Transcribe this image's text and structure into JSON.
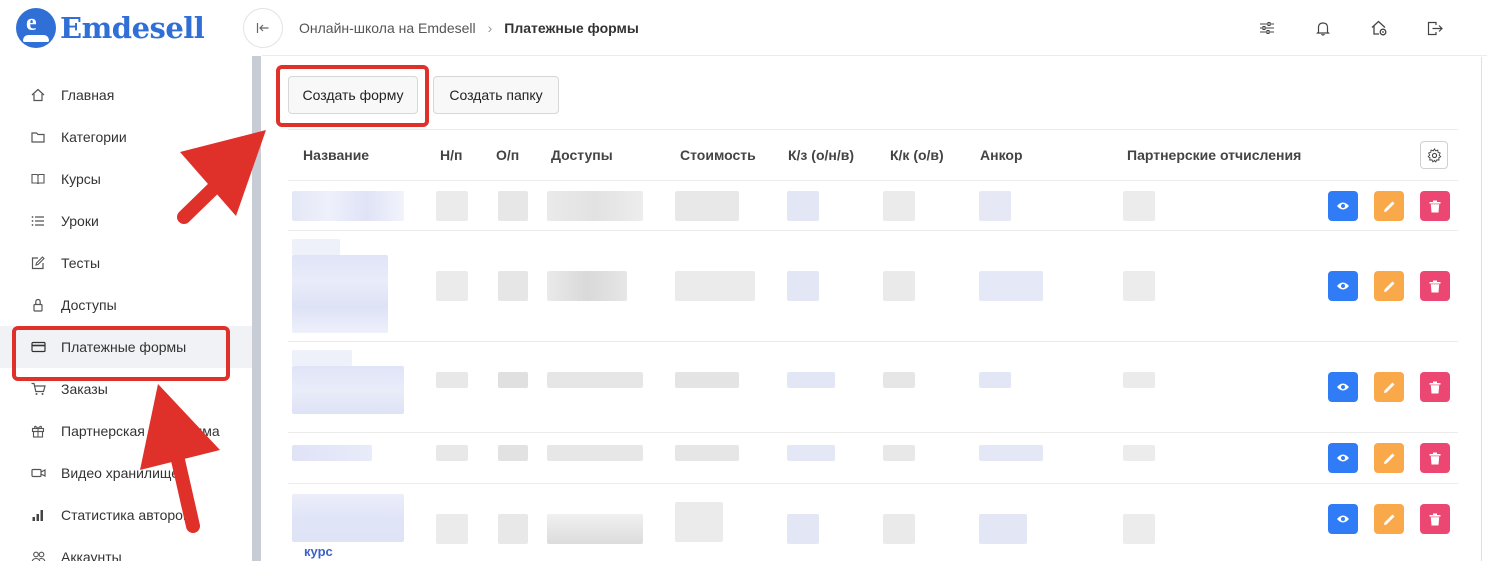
{
  "brand": {
    "name": "Emdesell",
    "badge_letter": "e",
    "color": "#2f6fd6"
  },
  "header": {
    "breadcrumb": [
      "Онлайн-школа на Emdesell",
      "Платежные формы"
    ],
    "icons": [
      "sliders-icon",
      "bell-icon",
      "home-settings-icon",
      "logout-icon"
    ]
  },
  "sidebar": {
    "items": [
      {
        "label": "Главная",
        "icon": "home-icon"
      },
      {
        "label": "Категории",
        "icon": "folder-icon"
      },
      {
        "label": "Курсы",
        "icon": "book-icon"
      },
      {
        "label": "Уроки",
        "icon": "list-icon"
      },
      {
        "label": "Тесты",
        "icon": "edit-icon"
      },
      {
        "label": "Доступы",
        "icon": "lock-icon"
      },
      {
        "label": "Платежные формы",
        "icon": "credit-card-icon",
        "active": true
      },
      {
        "label": "Заказы",
        "icon": "cart-icon"
      },
      {
        "label": "Партнерская программа",
        "icon": "gift-icon"
      },
      {
        "label": "Видео хранилище",
        "icon": "video-icon"
      },
      {
        "label": "Статистика авторов",
        "icon": "bar-chart-icon"
      },
      {
        "label": "Аккаунты",
        "icon": "users-icon"
      }
    ]
  },
  "toolbar": {
    "create_form": "Создать форму",
    "create_folder": "Создать папку"
  },
  "table": {
    "columns": [
      "Название",
      "Н/п",
      "О/п",
      "Доступы",
      "Стоимость",
      "К/з (о/н/в)",
      "К/к (о/в)",
      "Анкор",
      "Партнерские отчисления"
    ],
    "rows": [
      {
        "name": "",
        "note": "blurred"
      },
      {
        "name": "",
        "note": "blurred"
      },
      {
        "name": "",
        "note": "blurred"
      },
      {
        "name": "",
        "note": "blurred"
      },
      {
        "name": "курс",
        "note": "blurred"
      }
    ],
    "actions": [
      "eye-icon",
      "pencil-icon",
      "trash-icon"
    ]
  },
  "colors": {
    "highlight": "#e0302a",
    "view": "#2f7cf6",
    "edit": "#f9a84a",
    "delete": "#ec4772"
  }
}
